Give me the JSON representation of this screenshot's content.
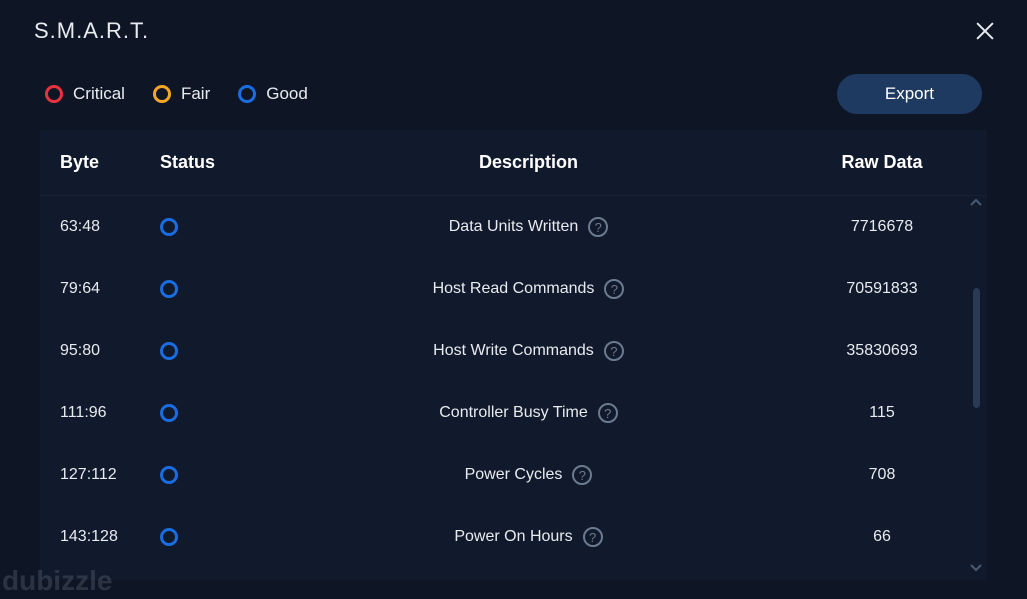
{
  "title": "S.M.A.R.T.",
  "legend": {
    "critical": "Critical",
    "fair": "Fair",
    "good": "Good"
  },
  "export_label": "Export",
  "columns": {
    "byte": "Byte",
    "status": "Status",
    "description": "Description",
    "raw_data": "Raw Data"
  },
  "rows": [
    {
      "byte": "63:48",
      "status": "good",
      "description": "Data Units Written",
      "raw": "7716678"
    },
    {
      "byte": "79:64",
      "status": "good",
      "description": "Host Read Commands",
      "raw": "70591833"
    },
    {
      "byte": "95:80",
      "status": "good",
      "description": "Host Write Commands",
      "raw": "35830693"
    },
    {
      "byte": "111:96",
      "status": "good",
      "description": "Controller Busy Time",
      "raw": "115"
    },
    {
      "byte": "127:112",
      "status": "good",
      "description": "Power Cycles",
      "raw": "708"
    },
    {
      "byte": "143:128",
      "status": "good",
      "description": "Power On Hours",
      "raw": "66"
    }
  ],
  "watermark": "dubizzle"
}
